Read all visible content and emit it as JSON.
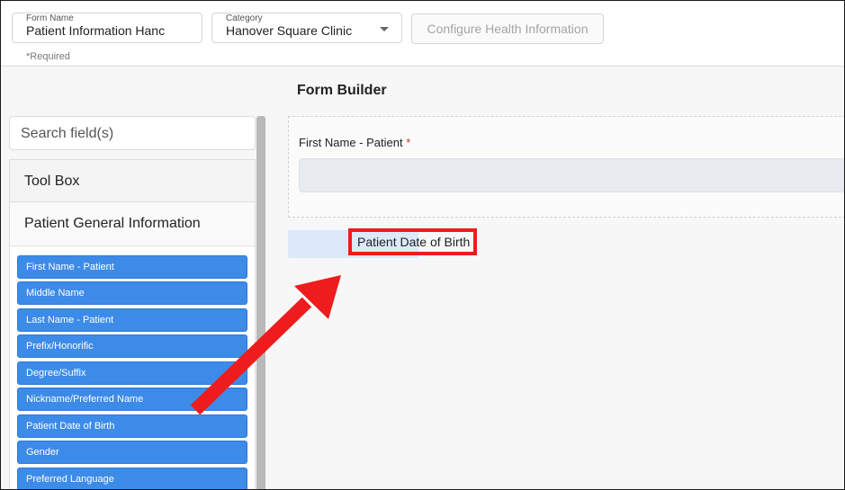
{
  "header": {
    "form_name": {
      "label": "Form Name",
      "value": "Patient Information Hanc"
    },
    "category": {
      "label": "Category",
      "value": "Hanover Square Clinic"
    },
    "configure_button": "Configure Health Information",
    "required_note": "*Required"
  },
  "builder": {
    "title": "Form Builder",
    "field_label": "First Name - Patient",
    "required_mark": "*",
    "dragging_label": "Patient Date of Birth"
  },
  "sidebar": {
    "search_placeholder": "Search field(s)",
    "toolbox_label": "Tool Box",
    "section_label": "Patient General Information",
    "items": [
      "First Name - Patient",
      "Middle Name",
      "Last Name - Patient",
      "Prefix/Honorific",
      "Degree/Suffix",
      "Nickname/Preferred Name",
      "Patient Date of Birth",
      "Gender",
      "Preferred Language"
    ]
  },
  "colors": {
    "pill_blue": "#3d8be8",
    "annotation_red": "#ee1c1c",
    "required_red": "#d32f2f"
  },
  "icons": {
    "category_caret": "chevron-down-icon",
    "annotation": "arrow-annotation"
  }
}
